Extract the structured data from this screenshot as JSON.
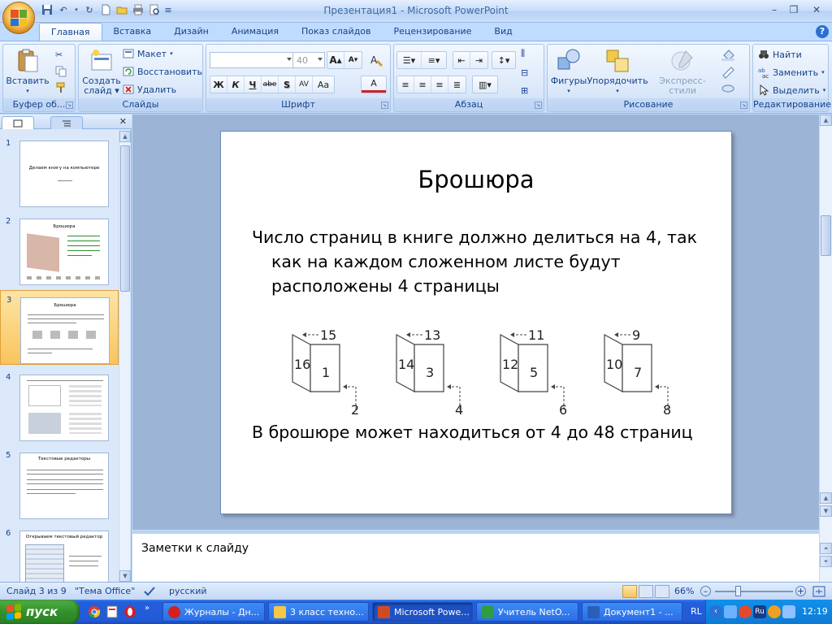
{
  "window": {
    "title": "Презентация1 - Microsoft PowerPoint"
  },
  "tabs": [
    {
      "label": "Главная",
      "active": true
    },
    {
      "label": "Вставка"
    },
    {
      "label": "Дизайн"
    },
    {
      "label": "Анимация"
    },
    {
      "label": "Показ слайдов"
    },
    {
      "label": "Рецензирование"
    },
    {
      "label": "Вид"
    }
  ],
  "ribbon": {
    "clipboard": {
      "label": "Буфер об...",
      "paste": "Вставить"
    },
    "slides": {
      "label": "Слайды",
      "new_slide": "Создать",
      "new_slide2": "слайд",
      "layout": "Макет",
      "reset": "Восстановить",
      "delete": "Удалить"
    },
    "font": {
      "label": "Шрифт",
      "font_name": "",
      "font_size": "40",
      "bold": "Ж",
      "italic": "К",
      "underline": "Ч",
      "strike": "abe",
      "shadow": "S",
      "spacing": "AV",
      "case": "Aa",
      "color": "A",
      "grow": "A",
      "shrink": "A"
    },
    "paragraph": {
      "label": "Абзац"
    },
    "drawing": {
      "label": "Рисование",
      "shapes": "Фигуры",
      "arrange": "Упорядочить",
      "quick_styles": "Экспресс-стили"
    },
    "editing": {
      "label": "Редактирование",
      "find": "Найти",
      "replace": "Заменить",
      "select": "Выделить"
    }
  },
  "thumbnails": [
    {
      "num": "1",
      "title": "Делаем книгу на компьютере"
    },
    {
      "num": "2",
      "title": "Брошюра"
    },
    {
      "num": "3",
      "title": "Брошюра",
      "selected": true
    },
    {
      "num": "4",
      "title": ""
    },
    {
      "num": "5",
      "title": "Текстовые редакторы"
    },
    {
      "num": "6",
      "title": "Открываем текстовый редактор"
    }
  ],
  "slide": {
    "title": "Брошюра",
    "bullet1": "Число страниц в книге должно делиться на 4, так как на каждом сложенном листе будут расположены 4 страницы",
    "bullet2": "В брошюре может находиться от 4 до 48 страниц",
    "diagram": [
      {
        "left": "16",
        "right": "1",
        "top": "15",
        "bottom": "2"
      },
      {
        "left": "14",
        "right": "3",
        "top": "13",
        "bottom": "4"
      },
      {
        "left": "12",
        "right": "5",
        "top": "11",
        "bottom": "6"
      },
      {
        "left": "10",
        "right": "7",
        "top": "9",
        "bottom": "8"
      }
    ]
  },
  "notes": {
    "placeholder": "Заметки к слайду"
  },
  "status": {
    "slide_info": "Слайд 3 из 9",
    "theme": "\"Тема Office\"",
    "language": "русский",
    "zoom": "66%"
  },
  "taskbar": {
    "start": "пуск",
    "items": [
      {
        "label": "Журналы - Дн...",
        "color": "#d42020"
      },
      {
        "label": "3 класс техно...",
        "color": "#f3c847"
      },
      {
        "label": "Microsoft Powe...",
        "color": "#d24b1f",
        "active": true
      },
      {
        "label": "Учитель NetO...",
        "color": "#2f9e3e"
      },
      {
        "label": "Документ1 - ...",
        "color": "#2a5fb8"
      }
    ],
    "lang": "RL",
    "tray_lang": "Ru",
    "clock": "12:19"
  }
}
